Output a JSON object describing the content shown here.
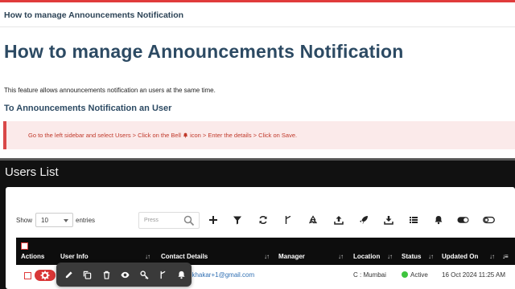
{
  "header": {
    "breadcrumb_title": "How to manage Announcements Notification"
  },
  "article": {
    "title": "How to manage Announcements Notification",
    "intro": "This feature allows announcements notification an users at the same time.",
    "subhead": "To Announcements Notification an User",
    "callout_before": "Go to the left sidebar and select Users > Click on the Bell",
    "callout_after": "icon > Enter the details > Click on Save."
  },
  "users_panel": {
    "title": "Users List",
    "show_label": "Show",
    "entries_value": "10",
    "entries_label": "entries",
    "search_placeholder": "Press",
    "toolbar_icons": [
      "add-icon",
      "filter-icon",
      "refresh-icon",
      "fork-icon",
      "recycle-icon",
      "upload-icon",
      "rocket-icon",
      "download-icon",
      "list-icon",
      "bell-icon",
      "toggle-on-icon",
      "toggle-off-icon"
    ],
    "columns": {
      "actions": "Actions",
      "user_info": "User Info",
      "contact": "Contact Details",
      "manager": "Manager",
      "location": "Location",
      "status": "Status",
      "updated": "Updated On"
    },
    "row": {
      "email": "ukhakar+1@gmail.com",
      "location": "C : Mumbai",
      "status": "Active",
      "updated": "16 Oct 2024 11:25 AM"
    },
    "row_actions": [
      "edit-icon",
      "copy-icon",
      "delete-icon",
      "view-icon",
      "key-icon",
      "fork-icon",
      "bell-icon"
    ]
  },
  "colors": {
    "accent_red": "#e03b3b",
    "heading": "#2c4a63",
    "callout_bg": "#fbeaea",
    "panel_bg": "#111111",
    "active_green": "#3ec43e",
    "link_blue": "#2f6fb3"
  }
}
